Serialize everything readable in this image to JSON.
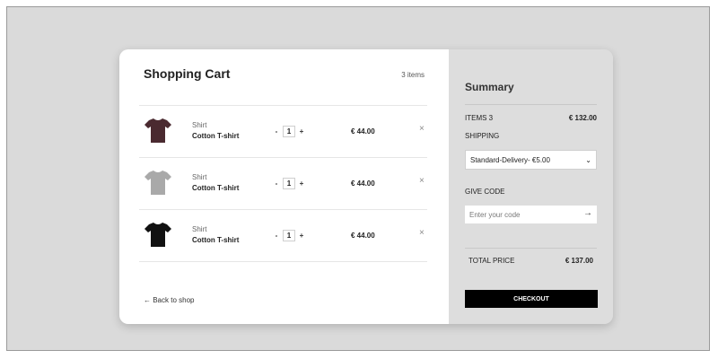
{
  "cart": {
    "title": "Shopping Cart",
    "count": "3 items",
    "back_label": "← Back to shop",
    "items": [
      {
        "category": "Shirt",
        "name": "Cotton T-shirt",
        "qty": "1",
        "minus": "-",
        "plus": "+",
        "price": "€ 44.00",
        "remove": "×",
        "color": "#4a2a30"
      },
      {
        "category": "Shirt",
        "name": "Cotton T-shirt",
        "qty": "1",
        "minus": "-",
        "plus": "+",
        "price": "€ 44.00",
        "remove": "×",
        "color": "#a9a9a9"
      },
      {
        "category": "Shirt",
        "name": "Cotton T-shirt",
        "qty": "1",
        "minus": "-",
        "plus": "+",
        "price": "€ 44.00",
        "remove": "×",
        "color": "#111111"
      }
    ]
  },
  "summary": {
    "title": "Summary",
    "items_label": "ITEMS 3",
    "items_value": "€ 132.00",
    "shipping_label": "SHIPPING",
    "shipping_selected": "Standard-Delivery- €5.00",
    "code_label": "GIVE CODE",
    "code_placeholder": "Enter your code",
    "code_arrow": "→",
    "total_label": "TOTAL PRICE",
    "total_value": "€ 137.00",
    "checkout_label": "CHECKOUT"
  },
  "colors": {
    "page_bg": "#dadada",
    "cart_bg": "#ffffff",
    "summary_bg": "#dddddd",
    "checkout_bg": "#000000"
  }
}
